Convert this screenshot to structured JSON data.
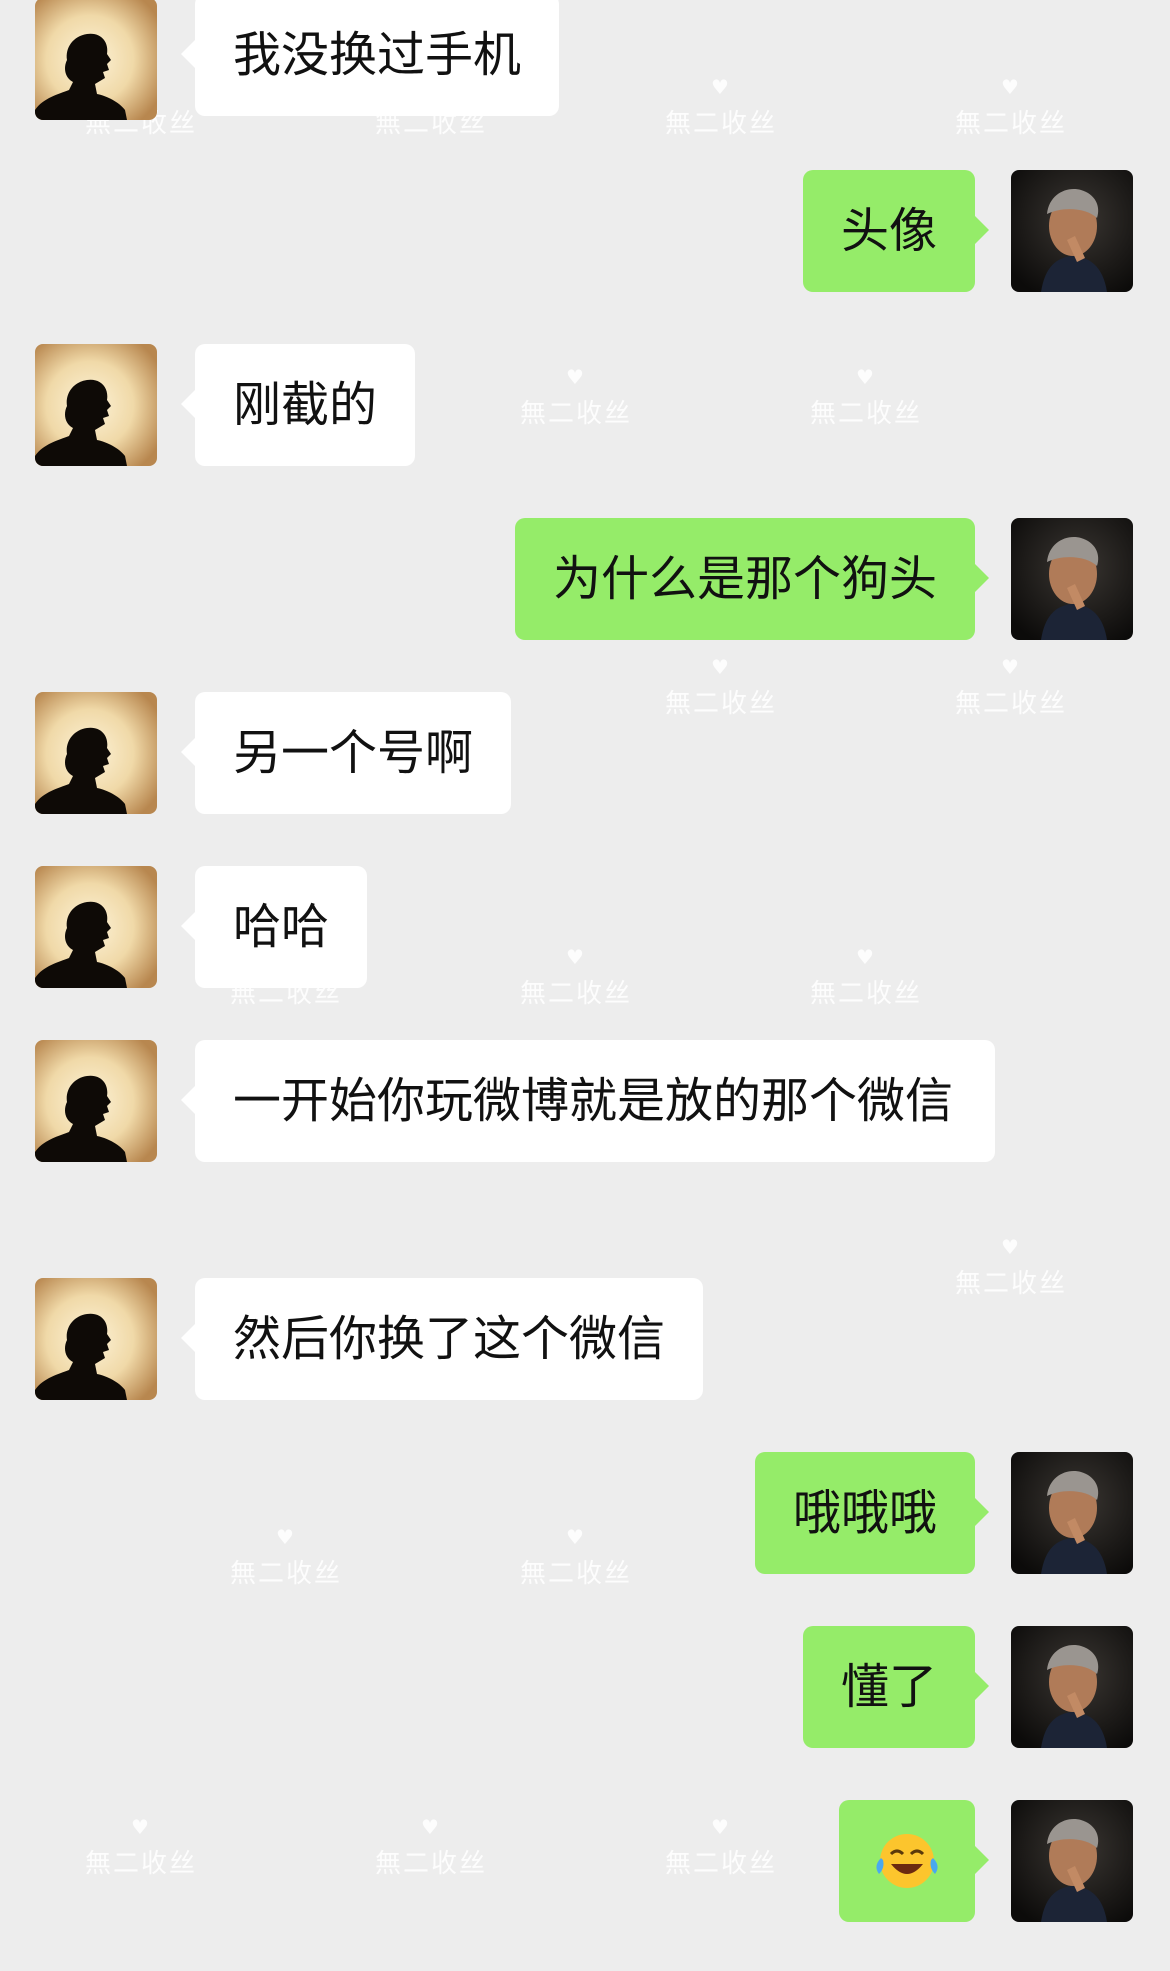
{
  "conversation": {
    "watermark_text": "無二收丝",
    "messages": [
      {
        "side": "left",
        "text": "我没换过手机"
      },
      {
        "side": "right",
        "text": "头像"
      },
      {
        "side": "left",
        "text": "刚截的"
      },
      {
        "side": "right",
        "text": "为什么是那个狗头"
      },
      {
        "side": "left",
        "text": "另一个号啊"
      },
      {
        "side": "left",
        "text": "哈哈"
      },
      {
        "side": "left",
        "text": "一开始你玩微博就是放的那个微信"
      },
      {
        "side": "left",
        "text": "然后你换了这个微信"
      },
      {
        "side": "right",
        "text": "哦哦哦"
      },
      {
        "side": "right",
        "text": "懂了"
      },
      {
        "side": "right",
        "text": "",
        "icon": "laughing-crying-emoji-icon"
      }
    ]
  },
  "colors": {
    "background": "#ededed",
    "bubble_self": "#95ec69",
    "bubble_other": "#ffffff"
  }
}
